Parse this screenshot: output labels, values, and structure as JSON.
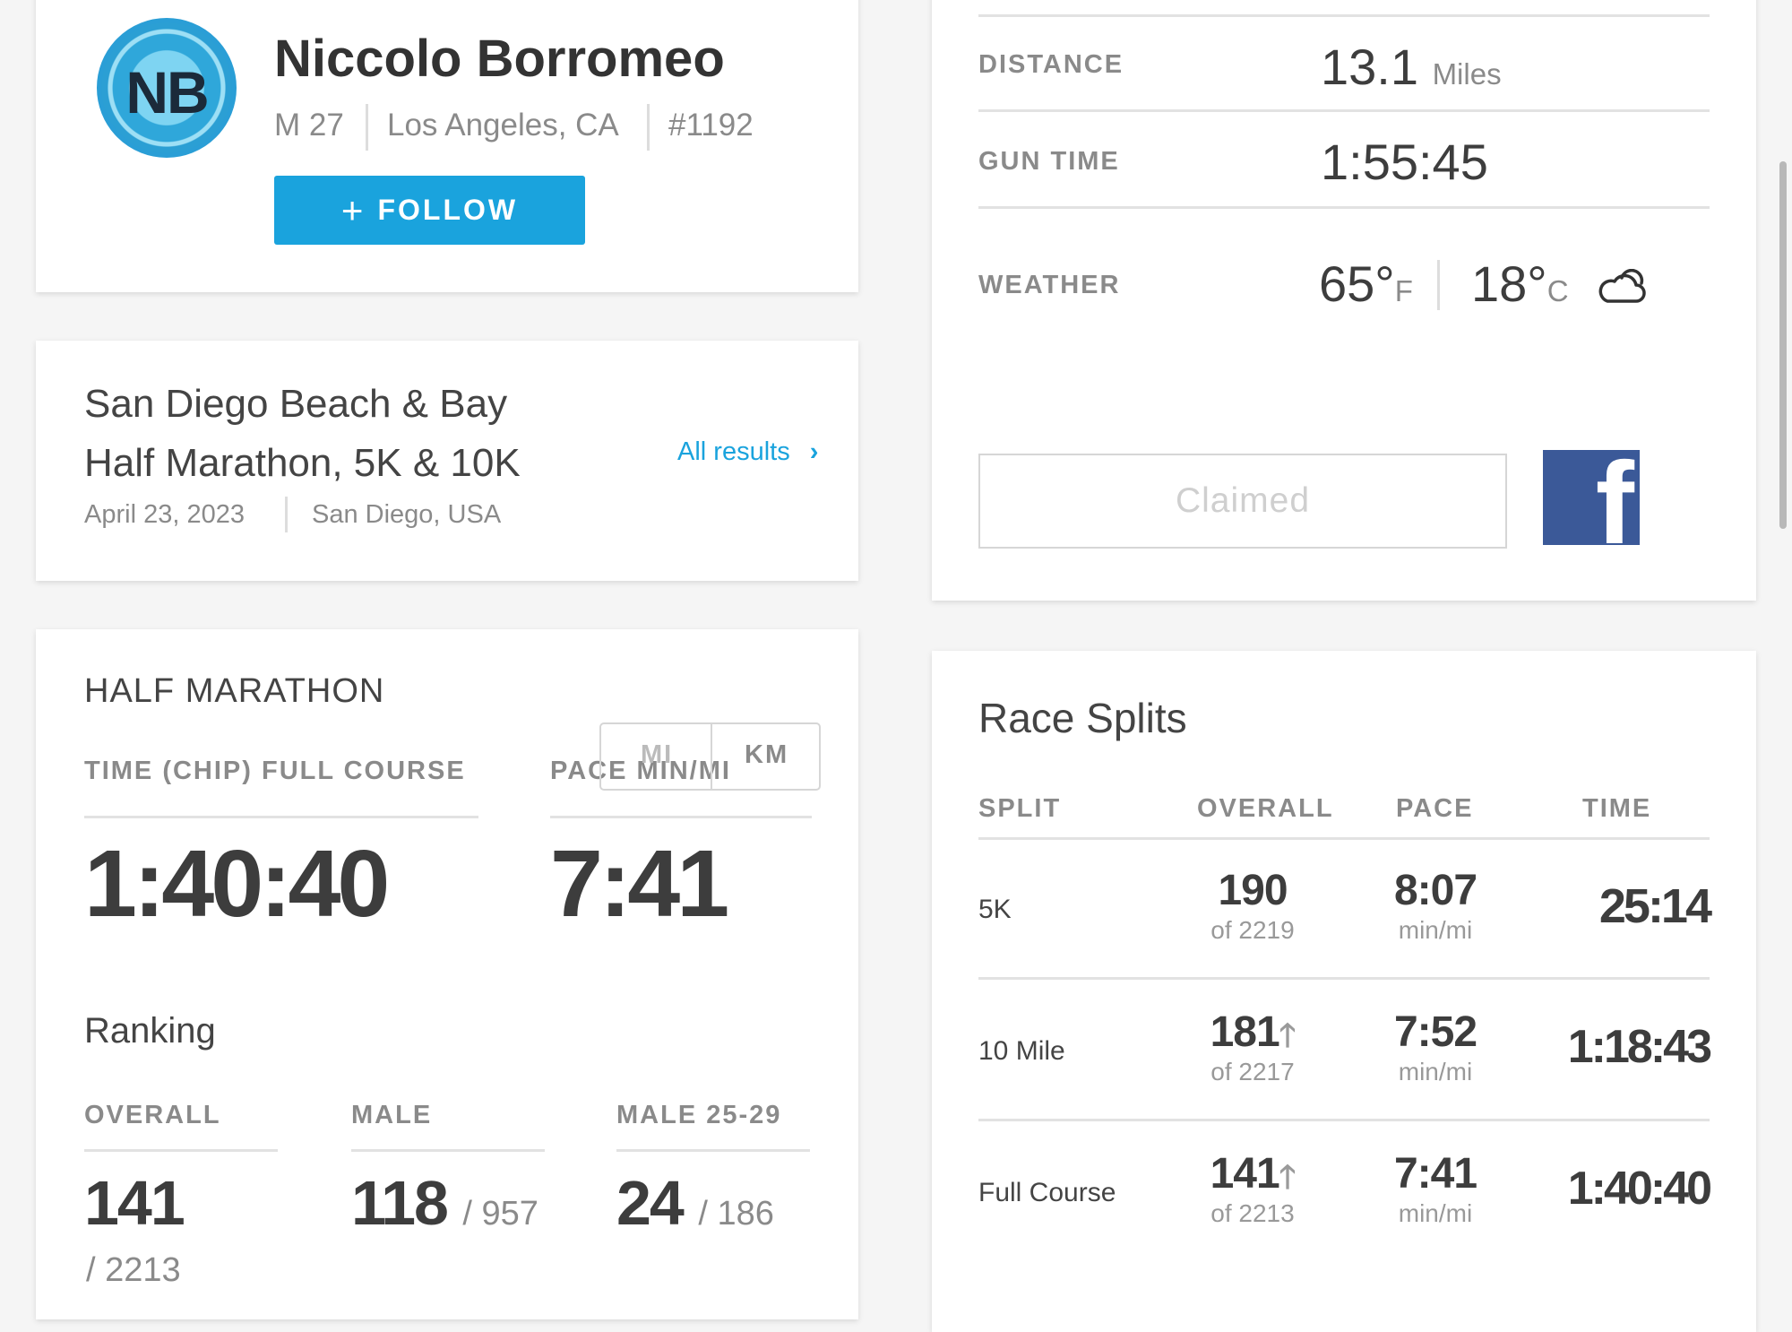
{
  "profile": {
    "initials": "NB",
    "name": "Niccolo Borromeo",
    "gender_age": "M 27",
    "location": "Los Angeles, CA",
    "bib": "#1192",
    "follow_label": "FOLLOW"
  },
  "event": {
    "name_line1": "San Diego Beach & Bay",
    "name_line2": "Half Marathon, 5K & 10K",
    "date": "April 23, 2023",
    "place": "San Diego, USA",
    "all_results_label": "All results"
  },
  "result": {
    "race": "HALF MARATHON",
    "time_label": "TIME (CHIP) FULL COURSE",
    "time": "1:40:40",
    "pace_label": "PACE MIN/MI",
    "pace": "7:41",
    "unit_mi": "MI",
    "unit_km": "KM"
  },
  "ranking": {
    "title": "Ranking",
    "overall_label": "OVERALL",
    "overall": "141",
    "overall_of": "/ 2213",
    "male_label": "MALE",
    "male": "118",
    "male_of": "/ 957",
    "group_label": "MALE 25-29",
    "group": "24",
    "group_of": "/ 186"
  },
  "stats": {
    "distance_label": "DISTANCE",
    "distance_value": "13.1",
    "distance_unit": "Miles",
    "gun_time_label": "GUN TIME",
    "gun_time": "1:55:45",
    "weather_label": "WEATHER",
    "temp_f": "65°",
    "unit_f": "F",
    "temp_c": "18°",
    "unit_c": "C",
    "weather_icon": "cloud-icon",
    "claimed_label": "Claimed",
    "social_icon": "facebook-icon"
  },
  "splits": {
    "title": "Race Splits",
    "headers": [
      "SPLIT",
      "OVERALL",
      "PACE",
      "TIME"
    ],
    "rows": [
      {
        "name": "5K",
        "overall": "190",
        "of": "of 2219",
        "pace": "8:07",
        "pace_unit": "min/mi",
        "time": "25:14",
        "arrow": false
      },
      {
        "name": "10 Mile",
        "overall": "181",
        "of": "of 2217",
        "pace": "7:52",
        "pace_unit": "min/mi",
        "time": "1:18:43",
        "arrow": true
      },
      {
        "name": "Full Course",
        "overall": "141",
        "of": "of 2213",
        "pace": "7:41",
        "pace_unit": "min/mi",
        "time": "1:40:40",
        "arrow": true
      }
    ]
  }
}
